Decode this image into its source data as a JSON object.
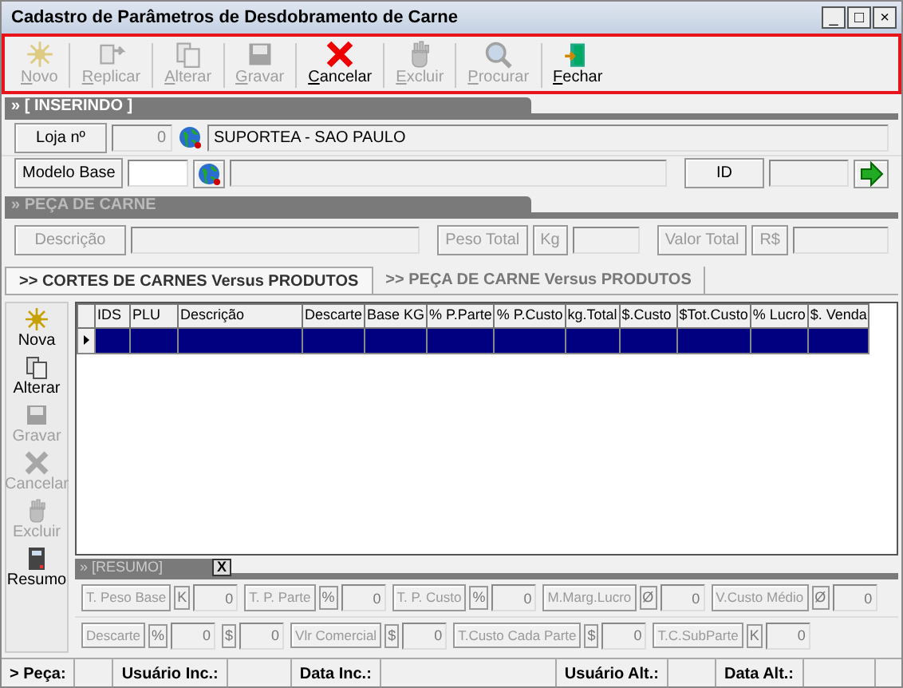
{
  "window": {
    "title": "Cadastro de Parâmetros de Desdobramento de Carne",
    "controls": [
      "_",
      "□",
      "×"
    ]
  },
  "toolbar": {
    "highlighted": true,
    "buttons": [
      {
        "label": "Novo",
        "disabled": true
      },
      {
        "label": "Replicar",
        "disabled": true
      },
      {
        "label": "Alterar",
        "disabled": true
      },
      {
        "label": "Gravar",
        "disabled": true
      },
      {
        "label": "Cancelar",
        "disabled": false
      },
      {
        "label": "Excluir",
        "disabled": true
      },
      {
        "label": "Procurar",
        "disabled": true
      },
      {
        "label": "Fechar",
        "disabled": false
      }
    ]
  },
  "header_section": {
    "title": "» [ INSERINDO ]",
    "store_label": "Loja nº",
    "store_number": "0",
    "store_name": "SUPORTEA - SAO PAULO",
    "base_model_label": "Modelo Base",
    "id_label": "ID"
  },
  "piece_section": {
    "title": "» PEÇA DE CARNE",
    "disabled": true,
    "description_label": "Descrição",
    "total_weight_label": "Peso Total",
    "weight_unit": "Kg",
    "total_value_label": "Valor Total",
    "currency_unit": "R$"
  },
  "tabs": [
    {
      "label": ">> CORTES DE CARNES Versus PRODUTOS",
      "selected": true
    },
    {
      "label": ">> PEÇA DE CARNE Versus PRODUTOS",
      "selected": false
    }
  ],
  "side_buttons": [
    {
      "label": "Nova",
      "disabled": false
    },
    {
      "label": "Alterar",
      "disabled": false
    },
    {
      "label": "Gravar",
      "disabled": true
    },
    {
      "label": "Cancelar",
      "disabled": true
    },
    {
      "label": "Excluir",
      "disabled": true
    },
    {
      "label": "Resumo",
      "disabled": false
    }
  ],
  "grid": {
    "columns": [
      "IDS",
      "PLU",
      "Descrição",
      "Descarte",
      "Base KG",
      "% P.Parte",
      "% P.Custo",
      "kg.Total",
      "$.Custo",
      "$Tot.Custo",
      "% Lucro",
      "$. Venda"
    ],
    "rows": [
      {
        "selected": true
      }
    ]
  },
  "summary": {
    "title": "» [RESUMO]",
    "close": "X",
    "rows": [
      [
        {
          "label": "T. Peso Base",
          "unit": "K",
          "value": "0"
        },
        {
          "label": "T. P. Parte",
          "unit": "%",
          "value": "0"
        },
        {
          "label": "T. P. Custo",
          "unit": "%",
          "value": "0"
        },
        {
          "label": "M.Marg.Lucro",
          "unit": "Ø",
          "value": "0"
        },
        {
          "label": "V.Custo Médio",
          "unit": "Ø",
          "value": "0"
        }
      ],
      [
        {
          "label": "Descarte",
          "unit": "%",
          "value": "0"
        },
        {
          "unit": "$",
          "value": "0"
        },
        {
          "label": "Vlr Comercial",
          "unit": "$",
          "value": "0"
        },
        {
          "label": "T.Custo Cada Parte",
          "unit": "$",
          "value": "0"
        },
        {
          "label": "T.C.SubParte",
          "unit": "K",
          "value": "0"
        }
      ]
    ]
  },
  "status_bar": [
    "> Peça:",
    "Usuário Inc.:",
    "Data Inc.:",
    "Usuário Alt.:",
    "Data Alt.:"
  ]
}
